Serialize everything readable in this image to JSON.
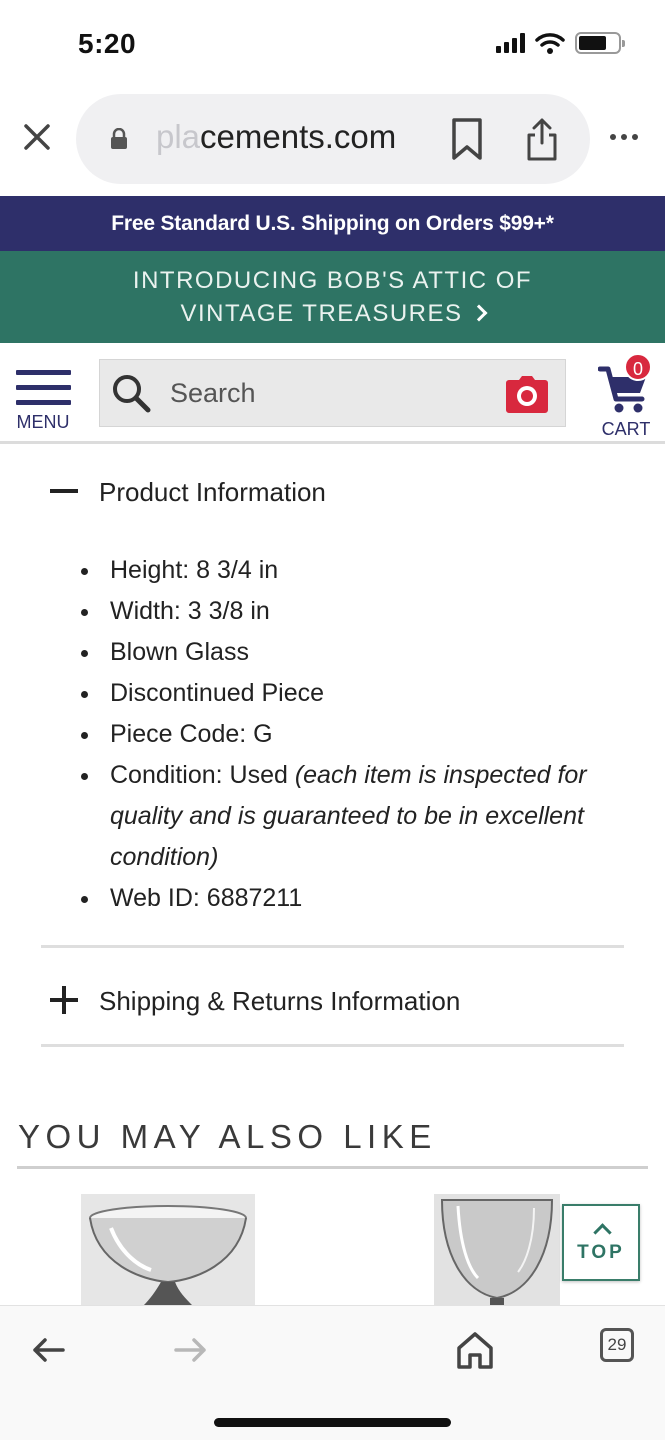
{
  "status_bar": {
    "time": "5:20"
  },
  "browser": {
    "url_prefix": "pla",
    "url_rest": "cements.com"
  },
  "shipping_banner": "Free Standard U.S. Shipping on Orders $99+*",
  "promo_banner": {
    "line1": "INTRODUCING BOB'S ATTIC OF",
    "line2": "VINTAGE TREASURES"
  },
  "header": {
    "menu_label": "MENU",
    "search_placeholder": "Search",
    "cart_label": "CART",
    "cart_count": "0"
  },
  "product_info": {
    "title": "Product Information",
    "items": [
      {
        "text": "Height: 8 3/4 in",
        "note": ""
      },
      {
        "text": "Width: 3 3/8 in",
        "note": ""
      },
      {
        "text": "Blown Glass",
        "note": ""
      },
      {
        "text": "Discontinued Piece",
        "note": ""
      },
      {
        "text": "Piece Code: G",
        "note": ""
      },
      {
        "text": "Condition: Used ",
        "note": "(each item is inspected for quality and is guaranteed to be in excellent condition)"
      },
      {
        "text": "Web ID: 6887211",
        "note": ""
      }
    ]
  },
  "shipping_returns": {
    "title": "Shipping & Returns Information"
  },
  "also_like": {
    "title": "YOU MAY ALSO LIKE"
  },
  "top_button": {
    "label": "TOP"
  },
  "toolbar": {
    "tab_count": "29"
  },
  "colors": {
    "navy": "#2e2f6a",
    "green": "#2e7464",
    "badge_red": "#d8283e"
  },
  "icons": [
    "close-icon",
    "lock-icon",
    "bookmark-icon",
    "share-icon",
    "more-icon",
    "menu-icon",
    "search-icon",
    "camera-icon",
    "cart-icon",
    "minus-icon",
    "plus-icon",
    "chevron-up-icon",
    "back-arrow-icon",
    "forward-arrow-icon",
    "home-icon",
    "tabs-icon"
  ]
}
